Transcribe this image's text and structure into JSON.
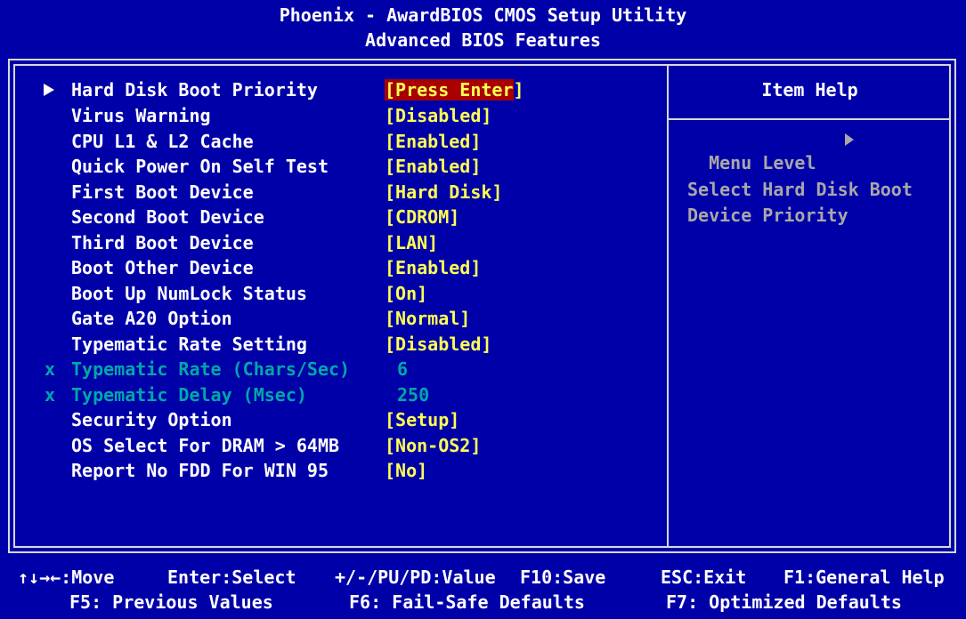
{
  "header": {
    "title": "Phoenix - AwardBIOS CMOS Setup Utility",
    "subtitle": "Advanced BIOS Features"
  },
  "menu": {
    "items": [
      {
        "label": "Hard Disk Boot Priority",
        "value_open": "[",
        "value": "Press Enter",
        "value_close": "]",
        "submenu": true,
        "selected": true
      },
      {
        "label": "Virus Warning",
        "value": "[Disabled]"
      },
      {
        "label": "CPU L1 & L2 Cache",
        "value": "[Enabled]"
      },
      {
        "label": "Quick Power On Self Test",
        "value": "[Enabled]"
      },
      {
        "label": "First Boot Device",
        "value": "[Hard Disk]"
      },
      {
        "label": "Second Boot Device",
        "value": "[CDROM]"
      },
      {
        "label": "Third Boot Device",
        "value": "[LAN]"
      },
      {
        "label": "Boot Other Device",
        "value": "[Enabled]"
      },
      {
        "label": "Boot Up NumLock Status",
        "value": "[On]"
      },
      {
        "label": "Gate A20 Option",
        "value": "[Normal]"
      },
      {
        "label": "Typematic Rate Setting",
        "value": "[Disabled]"
      },
      {
        "label": "Typematic Rate (Chars/Sec)",
        "value": "6",
        "disabled_marker": "x"
      },
      {
        "label": "Typematic Delay (Msec)",
        "value": "250",
        "disabled_marker": "x"
      },
      {
        "label": "Security Option",
        "value": "[Setup]"
      },
      {
        "label": "OS Select For DRAM > 64MB",
        "value": "[Non-OS2]"
      },
      {
        "label": "Report No FDD For WIN 95",
        "value": "[No]"
      }
    ]
  },
  "help": {
    "title": "Item Help",
    "menu_level_label": "Menu Level",
    "text_line1": "Select Hard Disk Boot",
    "text_line2": "Device Priority"
  },
  "footer": {
    "move": "↑↓→←:Move",
    "select": "Enter:Select",
    "value": "+/-/PU/PD:Value",
    "save": "F10:Save",
    "exit": "ESC:Exit",
    "general_help": "F1:General Help",
    "previous": "F5: Previous Values",
    "failsafe": "F6: Fail-Safe Defaults",
    "optimized": "F7: Optimized Defaults"
  },
  "colors": {
    "background": "#0000a8",
    "label": "#ffffff",
    "value": "#ffff54",
    "disabled": "#00a8a8",
    "highlight": "#a80000",
    "help_text": "#a8a8a8"
  }
}
